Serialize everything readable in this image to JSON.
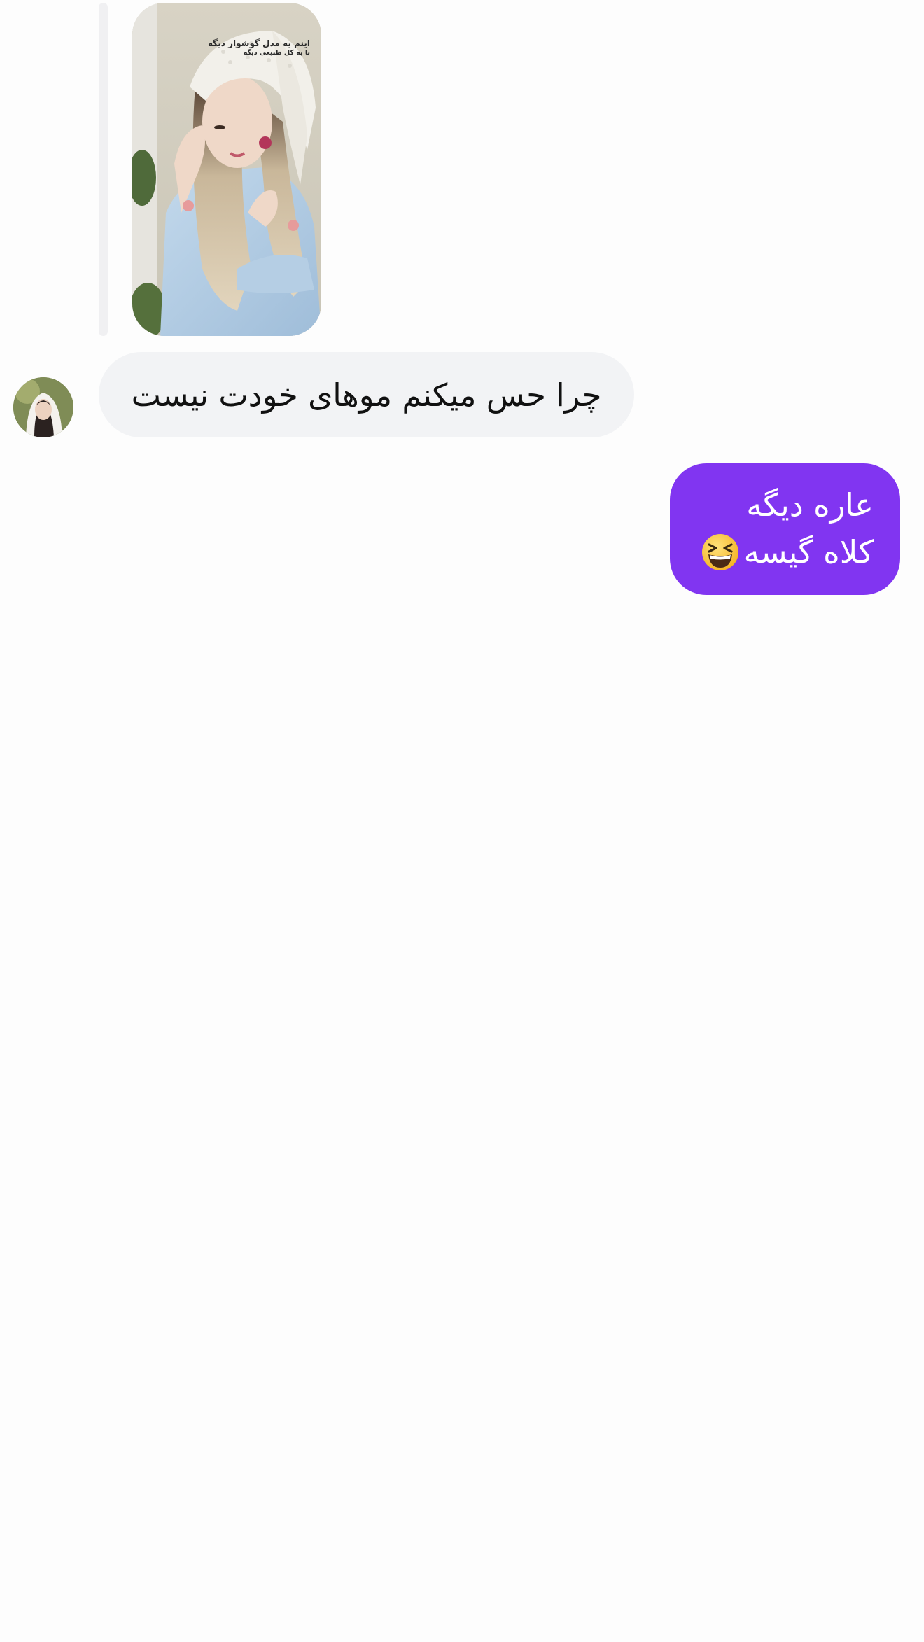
{
  "conversation": {
    "story_reply": {
      "caption_line_1": "اینم یه مدل گوشوار دیگه",
      "caption_line_2": "با یه کل طبیعی دیگه"
    },
    "incoming_message": {
      "text": "چرا حس میکنم موهای خودت نیست"
    },
    "outgoing_message": {
      "line_1": "عاره دیگه",
      "line_2": "کلاه گیسه",
      "emoji": "grinning-squinting-face-icon"
    }
  },
  "colors": {
    "outgoing_bubble": "#8135f1",
    "incoming_bubble": "#f2f3f5",
    "reply_bar": "#f0f0f2",
    "background": "#fdfdfd"
  }
}
